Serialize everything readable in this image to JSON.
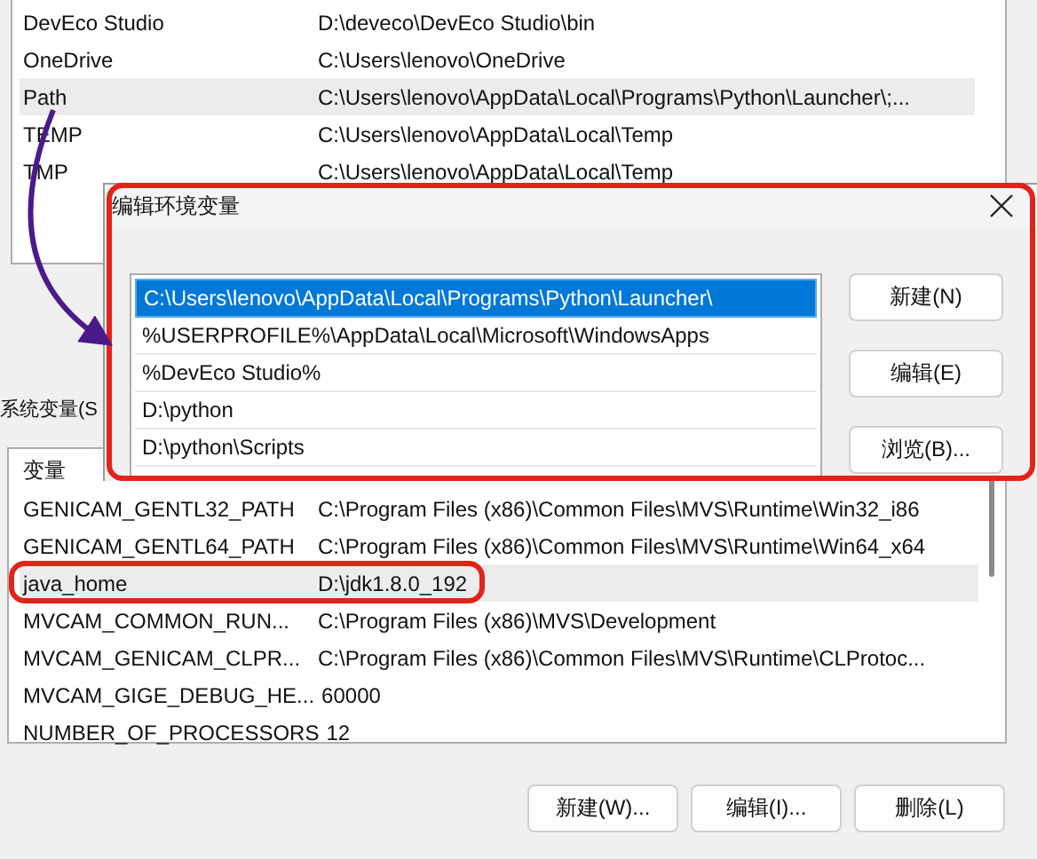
{
  "user_variables": {
    "rows": [
      {
        "name": "DevEco Studio",
        "value": "D:\\deveco\\DevEco Studio\\bin",
        "selected": false
      },
      {
        "name": "OneDrive",
        "value": "C:\\Users\\lenovo\\OneDrive",
        "selected": false
      },
      {
        "name": "Path",
        "value": "C:\\Users\\lenovo\\AppData\\Local\\Programs\\Python\\Launcher\\;...",
        "selected": true
      },
      {
        "name": "TEMP",
        "value": "C:\\Users\\lenovo\\AppData\\Local\\Temp",
        "selected": false
      },
      {
        "name": "TMP",
        "value": "C:\\Users\\lenovo\\AppData\\Local\\Temp",
        "selected": false
      }
    ]
  },
  "system_variables": {
    "label": "系统变量(S",
    "header": {
      "column_1": "变量"
    },
    "rows": [
      {
        "name": "GENICAM_GENTL32_PATH",
        "value": "C:\\Program Files (x86)\\Common Files\\MVS\\Runtime\\Win32_i86",
        "selected": false
      },
      {
        "name": "GENICAM_GENTL64_PATH",
        "value": "C:\\Program Files (x86)\\Common Files\\MVS\\Runtime\\Win64_x64",
        "selected": false
      },
      {
        "name": "java_home",
        "value": "D:\\jdk1.8.0_192",
        "selected": true
      },
      {
        "name": "MVCAM_COMMON_RUN...",
        "value": "C:\\Program Files (x86)\\MVS\\Development",
        "selected": false
      },
      {
        "name": "MVCAM_GENICAM_CLPR...",
        "value": "C:\\Program Files (x86)\\Common Files\\MVS\\Runtime\\CLProtoc...",
        "selected": false
      },
      {
        "name": "MVCAM_GIGE_DEBUG_HE...",
        "value": "60000",
        "selected": false
      },
      {
        "name": "NUMBER_OF_PROCESSORS",
        "value": "12",
        "selected": false
      }
    ],
    "buttons": [
      "新建(W)...",
      "编辑(I)...",
      "删除(L)"
    ]
  },
  "edit_dialog": {
    "title": "编辑环境变量",
    "entries": [
      {
        "text": "C:\\Users\\lenovo\\AppData\\Local\\Programs\\Python\\Launcher\\",
        "selected": true
      },
      {
        "text": "%USERPROFILE%\\AppData\\Local\\Microsoft\\WindowsApps",
        "selected": false
      },
      {
        "text": "%DevEco Studio%",
        "selected": false
      },
      {
        "text": "D:\\python",
        "selected": false
      },
      {
        "text": "D:\\python\\Scripts",
        "selected": false
      }
    ],
    "buttons": [
      "新建(N)",
      "编辑(E)",
      "浏览(B)..."
    ]
  }
}
